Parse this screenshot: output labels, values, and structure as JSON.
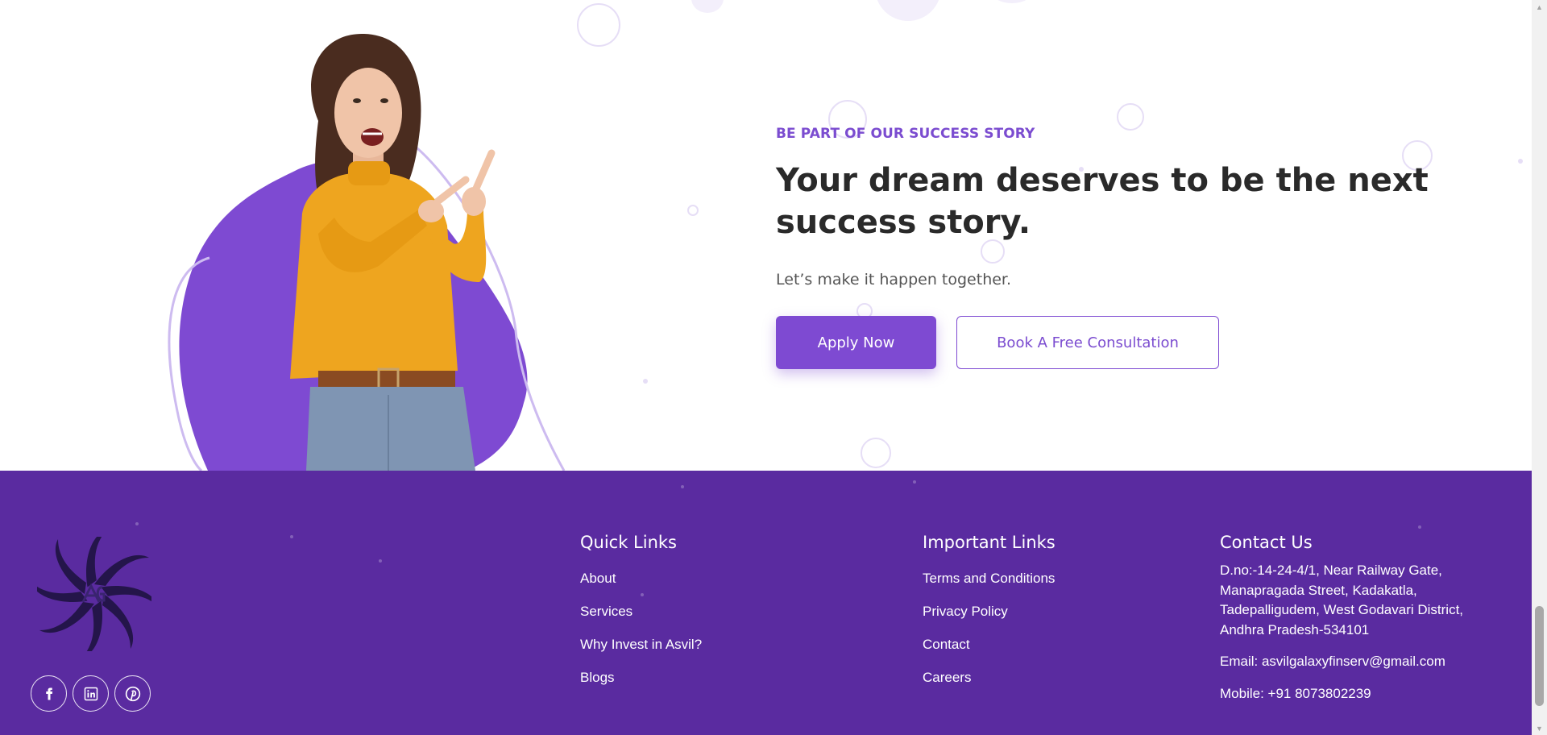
{
  "cta": {
    "eyebrow": "BE PART OF OUR SUCCESS STORY",
    "headline": "Your dream deserves to be the next success story.",
    "subhead": "Let’s make it happen together.",
    "apply_label": "Apply Now",
    "consult_label": "Book A Free Consultation"
  },
  "footer": {
    "quick_links": {
      "title": "Quick Links",
      "items": [
        "About",
        "Services",
        "Why Invest in Asvil?",
        "Blogs"
      ]
    },
    "important_links": {
      "title": "Important Links",
      "items": [
        "Terms and Conditions",
        "Privacy Policy",
        "Contact",
        "Careers"
      ]
    },
    "contact": {
      "title": "Contact Us",
      "address": "D.no:-14-24-4/1, Near Railway Gate, Manapragada Street, Kadakatla, Tadepalligudem, West Godavari District, Andhra Pradesh-534101",
      "email": "Email: asvilgalaxyfinserv@gmail.com",
      "mobile": "Mobile: +91 8073802239"
    },
    "socials": [
      {
        "icon": "facebook-icon"
      },
      {
        "icon": "linkedin-icon"
      },
      {
        "icon": "pinterest-icon"
      }
    ]
  },
  "colors": {
    "brand_purple": "#7e4ad2",
    "footer_purple": "#5a2ba0",
    "heading_dark": "#2a2a2a",
    "accent_orange": "#eea51f"
  }
}
